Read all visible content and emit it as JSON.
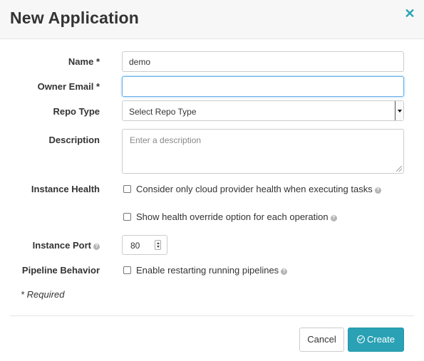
{
  "dialog": {
    "title": "New Application",
    "close_icon": "close-icon",
    "accent_color": "#2aa1b4"
  },
  "fields": {
    "name": {
      "label": "Name *",
      "value": "demo"
    },
    "owner_email": {
      "label": "Owner Email *",
      "value": ""
    },
    "repo_type": {
      "label": "Repo Type",
      "selected": "Select Repo Type"
    },
    "description": {
      "label": "Description",
      "placeholder": "Enter a description"
    },
    "instance_health": {
      "label": "Instance Health",
      "option1": "Consider only cloud provider health when executing tasks",
      "option2": "Show health override option for each operation"
    },
    "instance_port": {
      "label": "Instance Port",
      "value": "80"
    },
    "pipeline_behavior": {
      "label": "Pipeline Behavior",
      "option": "Enable restarting running pipelines"
    }
  },
  "required_note": "* Required",
  "buttons": {
    "cancel": "Cancel",
    "create": "Create"
  }
}
